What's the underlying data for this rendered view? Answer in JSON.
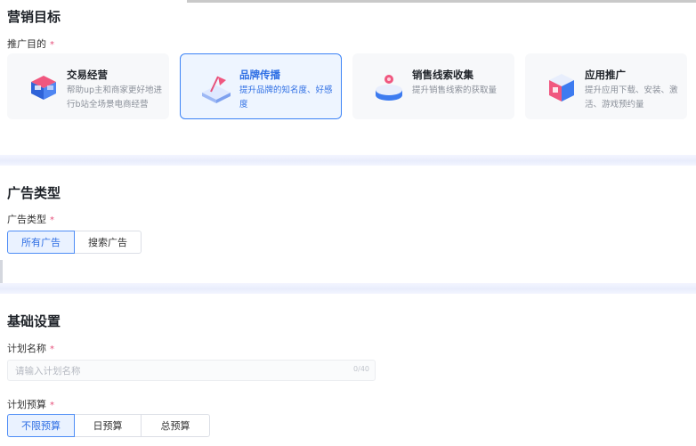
{
  "marketing_goal": {
    "title": "营销目标",
    "promotion_label": "推广目的",
    "required_mark": "*",
    "cards": [
      {
        "title": "交易经营",
        "desc": "帮助up主和商家更好地进行b站全场景电商经营",
        "icon": "shop-cube-icon",
        "active": false
      },
      {
        "title": "品牌传播",
        "desc": "提升品牌的知名度、好感度",
        "icon": "brand-flag-icon",
        "active": true
      },
      {
        "title": "销售线索收集",
        "desc": "提升销售线索的获取量",
        "icon": "lead-disc-icon",
        "active": false
      },
      {
        "title": "应用推广",
        "desc": "提升应用下载、安装、激活、游戏预约量",
        "icon": "app-box-icon",
        "active": false
      }
    ]
  },
  "ad_type": {
    "title": "广告类型",
    "label": "广告类型",
    "required_mark": "*",
    "options": [
      "所有广告",
      "搜索广告"
    ],
    "selected": "所有广告"
  },
  "basic_settings": {
    "title": "基础设置",
    "plan_name_label": "计划名称",
    "plan_name_placeholder": "请输入计划名称",
    "plan_name_value": "",
    "plan_name_counter": "0/40",
    "budget_label": "计划预算",
    "required_mark": "*",
    "budget_options": [
      "不限预算",
      "日预算",
      "总预算"
    ],
    "budget_selected": "不限预算"
  },
  "colors": {
    "accent": "#2f6fe4",
    "accent_bg": "#eaf2ff",
    "required": "#e6507a",
    "card_bg": "#f7f8fa"
  }
}
